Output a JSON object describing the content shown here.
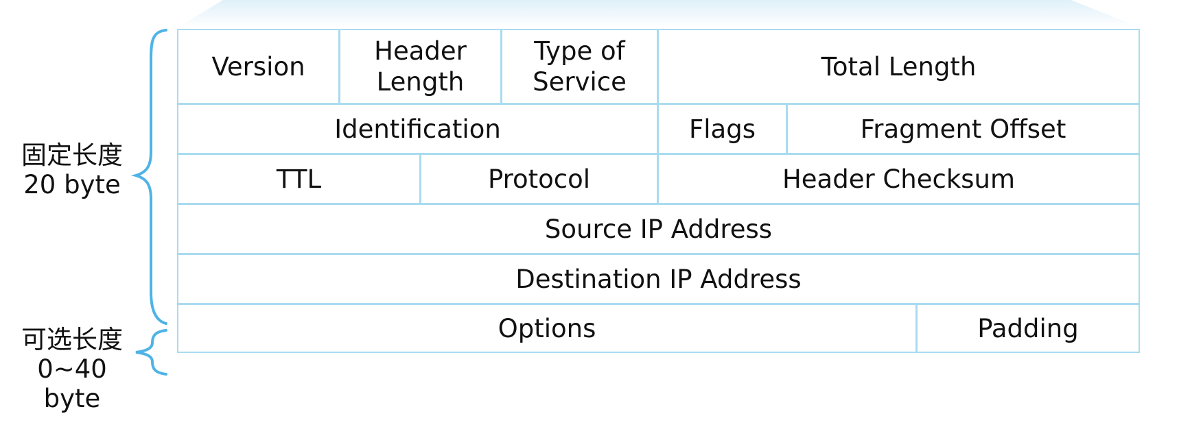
{
  "diagram": {
    "rows": [
      {
        "fields": [
          {
            "label": "Version"
          },
          {
            "label": "Header\nLength"
          },
          {
            "label": "Type of\nService"
          },
          {
            "label": "Total Length"
          }
        ]
      },
      {
        "fields": [
          {
            "label": "Identification"
          },
          {
            "label": "Flags"
          },
          {
            "label": "Fragment Offset"
          }
        ]
      },
      {
        "fields": [
          {
            "label": "TTL"
          },
          {
            "label": "Protocol"
          },
          {
            "label": "Header Checksum"
          }
        ]
      },
      {
        "fields": [
          {
            "label": "Source IP Address"
          }
        ]
      },
      {
        "fields": [
          {
            "label": "Destination IP Address"
          }
        ]
      },
      {
        "fields": [
          {
            "label": "Options"
          },
          {
            "label": "Padding"
          }
        ]
      }
    ],
    "brackets": {
      "fixed": {
        "label": "固定长度\n20 byte"
      },
      "optional": {
        "label": "可选长度\n0~40\nbyte"
      }
    }
  },
  "colors": {
    "cell_border": "#a9dbef",
    "brace": "#4fb3e6",
    "top_shade": "#eaf5fb",
    "text": "#111111"
  }
}
